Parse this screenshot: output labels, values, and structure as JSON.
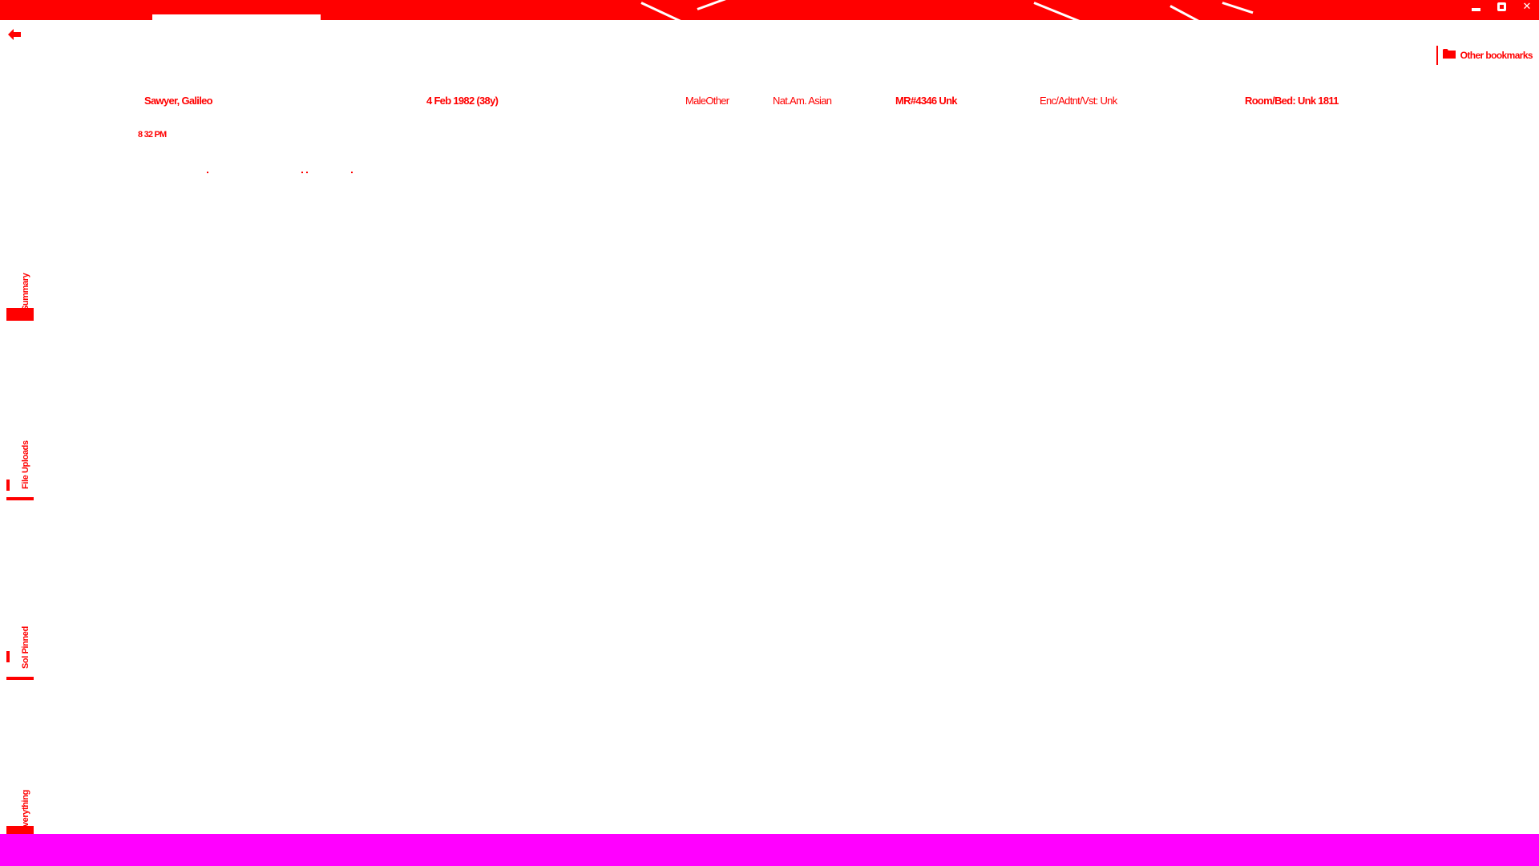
{
  "window": {
    "minimize_icon": "minimize-icon",
    "maximize_icon": "restore-icon",
    "close_icon": "close-icon",
    "close_glyph": "✕"
  },
  "nav": {
    "back_icon": "back-arrow-icon"
  },
  "bookmarks": {
    "folder_icon": "folder-icon",
    "label": "Other bookmarks"
  },
  "patient": {
    "name": "Sawyer, Galileo",
    "dob": "4 Feb 1982 (38y)",
    "sex": "MaleOther",
    "race": "Nat.Am. Asian",
    "mrn": "MR#4346 Unk",
    "encounter": "Enc/Adtnt/Vst: Unk",
    "room": "Room/Bed: Unk 1811"
  },
  "time": "8 32 PM",
  "sidebar": {
    "tabs": [
      {
        "label": "Summary"
      },
      {
        "label": "File Uploads"
      },
      {
        "label": "Sol Pinned"
      },
      {
        "label": "Everything"
      }
    ]
  },
  "colors": {
    "accent": "#ff0000",
    "bottom_bar": "#ff00ff",
    "background": "#ffffff"
  }
}
